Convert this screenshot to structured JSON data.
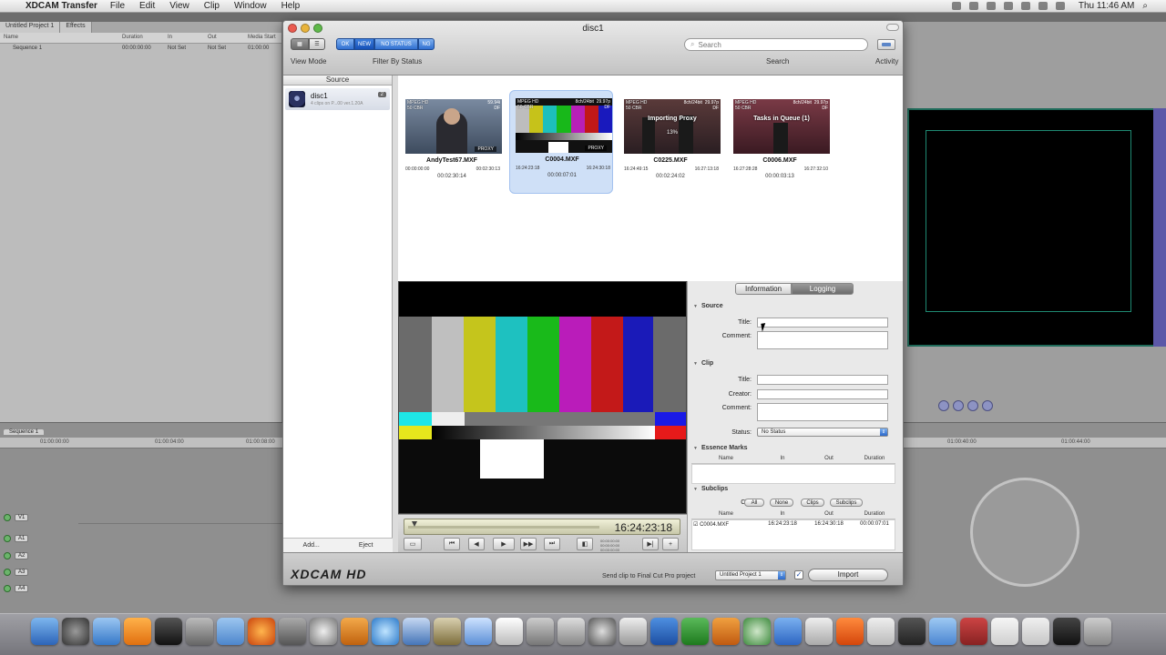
{
  "menubar": {
    "app_name": "XDCAM Transfer",
    "menus": [
      "File",
      "Edit",
      "View",
      "Clip",
      "Window",
      "Help"
    ],
    "clock": "Thu 11:46 AM"
  },
  "window": {
    "title": "disc1",
    "toolbar": {
      "view_mode_label": "View Mode",
      "filter_label": "Filter By Status",
      "filter_buttons": [
        "OK",
        "NEW",
        "NO STATUS",
        "NG"
      ],
      "search_label": "Search",
      "search_placeholder": "Search",
      "activity_label": "Activity"
    },
    "source_panel": {
      "header": "Source",
      "disc": {
        "name": "disc1",
        "subtitle": "4 clips on P...00 ver.1.20A",
        "badge": "2"
      },
      "add_label": "Add...",
      "eject_label": "Eject"
    },
    "clips": [
      {
        "meta_l": "MPEG HD\n50 CBR",
        "meta_r": "59.94i\nDF",
        "name": "AndyTest67.MXF",
        "tc_in": "00:00:00:00",
        "tc_out": "00:02:30:13",
        "duration": "00:02:30:14",
        "badge": "PROXY",
        "overlay": "",
        "pct": "",
        "selected": false
      },
      {
        "meta_l": "MPEG HD\n50 CBR",
        "meta_r": "8ch/24bit  29.97p\nDF",
        "name": "C0004.MXF",
        "tc_in": "16:24:23:18",
        "tc_out": "16:24:30:18",
        "duration": "00:00:07:01",
        "badge": "PROXY",
        "overlay": "",
        "pct": "",
        "selected": true
      },
      {
        "meta_l": "MPEG HD\n50 CBR",
        "meta_r": "8ch/24bit  29.97p\nDF",
        "name": "C0225.MXF",
        "tc_in": "16:24:49:15",
        "tc_out": "16:27:13:18",
        "duration": "00:02:24:02",
        "badge": "",
        "overlay": "Importing Proxy",
        "pct": "13%",
        "selected": false
      },
      {
        "meta_l": "MPEG HD\n50 CBR",
        "meta_r": "8ch/24bit  29.97p\nDF",
        "name": "C0006.MXF",
        "tc_in": "16:27:28:28",
        "tc_out": "16:27:32:10",
        "duration": "00:00:03:13",
        "badge": "",
        "overlay": "Tasks in Queue (1)",
        "pct": "",
        "selected": false
      }
    ],
    "transport": {
      "timecode": "16:24:23:18",
      "mini_tc": "00:00:00:00\n00:00:00:00\n00:00:00:00",
      "position": 0.02
    },
    "info_panel": {
      "tabs": [
        "Information",
        "Logging"
      ],
      "active_tab": "Logging",
      "source_section": "Source",
      "title_label": "Title:",
      "comment_label": "Comment:",
      "clip_section": "Clip",
      "creator_label": "Creator:",
      "status_label": "Status:",
      "status_value": "No Status",
      "essence_section": "Essence Marks",
      "essence_cols": [
        "Name",
        "In",
        "Out",
        "Duration"
      ],
      "subclips_section": "Subclips",
      "check_label": "Check:",
      "check_buttons": [
        "All",
        "None",
        "Clips",
        "Subclips"
      ],
      "subclip_cols": [
        "Name",
        "In",
        "Out",
        "Duration"
      ],
      "subclip_rows": [
        {
          "name": "C0004.MXF",
          "in": "16:24:23:18",
          "out": "16:24:30:18",
          "duration": "00:00:07:01",
          "checked": true
        }
      ]
    },
    "footer": {
      "logo": "XDCAM HD",
      "send_label": "Send clip to Final Cut Pro project",
      "project": "Untitled Project 1",
      "send_checked": true,
      "import_label": "Import"
    }
  },
  "background": {
    "browser_tabs": [
      "Untitled Project 1",
      "Effects"
    ],
    "browser_cols": [
      "Name",
      "Duration",
      "In",
      "Out",
      "Media Start"
    ],
    "browser_row": {
      "name": "Sequence 1",
      "duration": "00:00:00:00",
      "in": "Not Set",
      "out": "Not Set",
      "media": "01:00:00"
    },
    "timeline_tab": "Sequence 1",
    "timeline_tc": "01:00:00:00",
    "ruler": [
      "01:00:04:00",
      "01:00:08:00",
      "01:00:40:00",
      "01:00:44:00"
    ],
    "tracks": [
      "V1",
      "A1",
      "A2",
      "A3",
      "A4"
    ]
  }
}
